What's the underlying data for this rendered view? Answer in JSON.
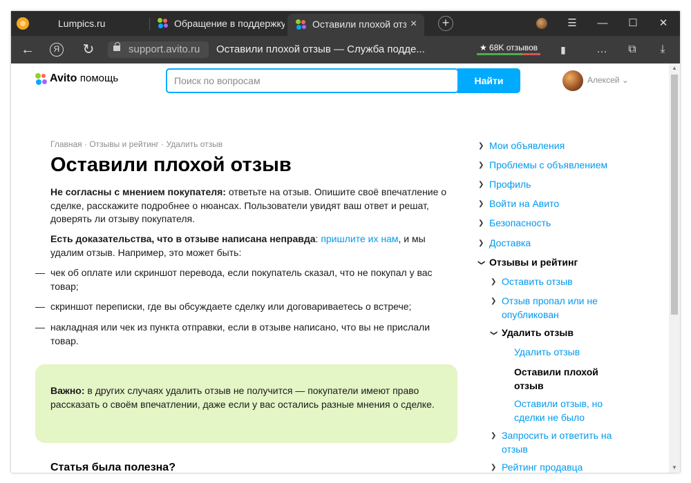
{
  "browser": {
    "tabs": [
      {
        "title": "Lumpics.ru"
      },
      {
        "title": "Обращение в поддержку"
      },
      {
        "title": "Оставили плохой отзыв",
        "close": "×"
      }
    ],
    "new_tab": "+",
    "window_controls": {
      "menu": "☰",
      "minimize": "—",
      "maximize": "☐",
      "close": "✕"
    },
    "address": {
      "back": "←",
      "ya": "Я",
      "reload": "↻",
      "domain": "support.avito.ru",
      "page_title": "Оставили плохой отзыв — Служба подде...",
      "reviews_badge": "★ 68K отзывов",
      "reviews_positive_share": 0.72,
      "bookmark": "🔖",
      "more": "…",
      "download": "⤓"
    }
  },
  "header": {
    "logo_brand": "Avito",
    "logo_sub": "помощь",
    "search_placeholder": "Поиск по вопросам",
    "search_button": "Найти",
    "user_name": "Алексей",
    "user_chevron": "⌄"
  },
  "article": {
    "breadcrumb": "Главная · Отзывы и рейтинг · Удалить отзыв",
    "title": "Оставили плохой отзыв",
    "p1_bold": "Не согласны с мнением покупателя:",
    "p1_text": " ответьте на отзыв. Опишите своё впечатление о сделке, расскажите подробнее о нюансах. Пользователи увидят ваш ответ и решат, доверять ли отзыву покупателя.",
    "p2_bold": "Есть доказательства, что в отзыве написана неправда",
    "p2_colon": ": ",
    "p2_link": "пришлите их нам",
    "p2_text": ", и мы удалим отзыв. Например, это может быть:",
    "dash": "—",
    "list": [
      "чек об оплате или скриншот перевода, если покупатель сказал, что не покупал у вас товар;",
      "скриншот переписки, где вы обсуждаете сделку или договариваетесь о встрече;",
      "накладная или чек из пункта отправки, если в отзыве написано, что вы не прислали товар."
    ],
    "important_bold": "Важно:",
    "important_text": " в других случаях удалить отзыв не получится — покупатели имеют право рассказать о своём впечатлении, даже если у вас остались разные мнения о сделке.",
    "helpful": "Статья была полезна?"
  },
  "sidebar": {
    "items": [
      {
        "label": "Мои объявления"
      },
      {
        "label": "Проблемы с объявлением"
      },
      {
        "label": "Профиль"
      },
      {
        "label": "Войти на Авито"
      },
      {
        "label": "Безопасность"
      },
      {
        "label": "Доставка"
      },
      {
        "label": "Отзывы и рейтинг"
      },
      {
        "label": "Оставить отзыв"
      },
      {
        "label": "Отзыв пропал или не опубликован"
      },
      {
        "label": "Удалить отзыв"
      },
      {
        "label": "Удалить отзыв"
      },
      {
        "label": "Оставили плохой отзыв"
      },
      {
        "label": "Оставили отзыв, но сделки не было"
      },
      {
        "label": "Запросить и ответить на отзыв"
      },
      {
        "label": "Рейтинг продавца"
      }
    ],
    "chevron_right": "❯",
    "chevron_down": "❯"
  },
  "colors": {
    "accent": "#00aaff",
    "link": "#0099ee",
    "callout": "#e4f5c6"
  }
}
